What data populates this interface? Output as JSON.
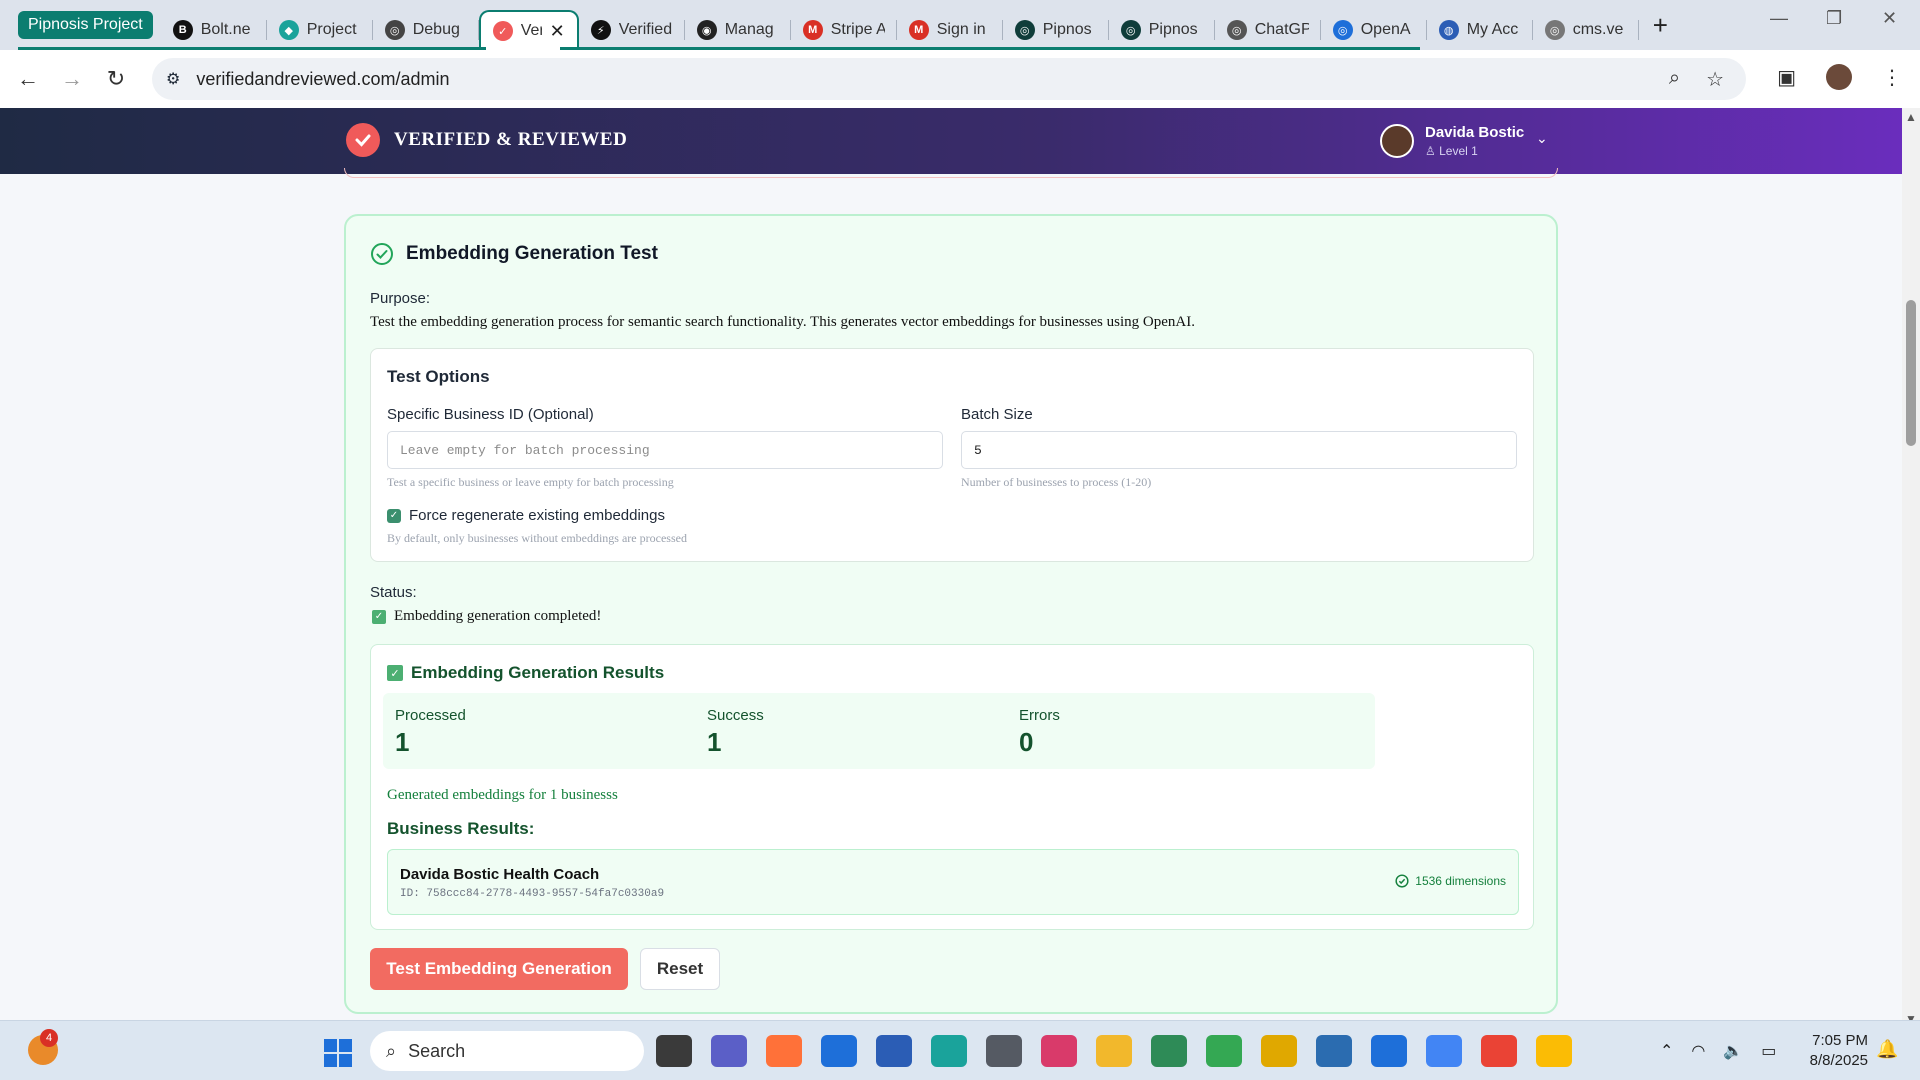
{
  "browser": {
    "group_chip": "Pipnosis Project",
    "tabs": [
      {
        "label": "Bolt.ne",
        "fav": "B",
        "color": "#111111"
      },
      {
        "label": "Project",
        "fav": "◆",
        "color": "#1aa39b"
      },
      {
        "label": "Debug",
        "fav": "◎",
        "color": "#444444"
      },
      {
        "label": "Ver",
        "fav": "✓",
        "color": "#f05a5a",
        "active": true
      },
      {
        "label": "Verified",
        "fav": "⚡",
        "color": "#111111"
      },
      {
        "label": "Manag",
        "fav": "◉",
        "color": "#222222"
      },
      {
        "label": "Stripe A",
        "fav": "M",
        "color": "#d93025"
      },
      {
        "label": "Sign in",
        "fav": "M",
        "color": "#d93025"
      },
      {
        "label": "Pipnos",
        "fav": "◎",
        "color": "#0f3d3a"
      },
      {
        "label": "Pipnos",
        "fav": "◎",
        "color": "#0f3d3a"
      },
      {
        "label": "ChatGP",
        "fav": "◎",
        "color": "#555555"
      },
      {
        "label": "OpenA",
        "fav": "◎",
        "color": "#1e6fd9"
      },
      {
        "label": "My Acc",
        "fav": "◍",
        "color": "#2b5db5"
      },
      {
        "label": "cms.ve",
        "fav": "◎",
        "color": "#777777"
      }
    ],
    "tab_close": "✕",
    "new_tab": "+",
    "url": "verifiedandreviewed.com/admin"
  },
  "site": {
    "brand": "VERIFIED & REVIEWED",
    "user_name": "Davida Bostic",
    "user_level": "Level 1"
  },
  "card": {
    "title": "Embedding Generation Test",
    "purpose_label": "Purpose:",
    "purpose_text": "Test the embedding generation process for semantic search functionality. This generates vector embeddings for businesses using OpenAI.",
    "options": {
      "title": "Test Options",
      "business_id_label": "Specific Business ID (Optional)",
      "business_id_placeholder": "Leave empty for batch processing",
      "business_id_help": "Test a specific business or leave empty for batch processing",
      "batch_size_label": "Batch Size",
      "batch_size_value": "5",
      "batch_size_help": "Number of businesses to process (1-20)",
      "force_label": "Force regenerate existing embeddings",
      "force_checked": true,
      "force_help": "By default, only businesses without embeddings are processed"
    },
    "status_label": "Status:",
    "status_text": "Embedding generation completed!",
    "results": {
      "title": "Embedding Generation Results",
      "stats": [
        {
          "label": "Processed",
          "value": "1"
        },
        {
          "label": "Success",
          "value": "1"
        },
        {
          "label": "Errors",
          "value": "0"
        }
      ],
      "generated_text": "Generated embeddings for 1 businesss",
      "business_results_label": "Business Results:",
      "business": {
        "name": "Davida Bostic Health Coach",
        "id": "ID: 758ccc84-2778-4493-9557-54fa7c0330a9",
        "dimensions": "1536 dimensions"
      }
    },
    "buttons": {
      "test": "Test Embedding Generation",
      "reset": "Reset"
    }
  },
  "taskbar": {
    "search_label": "Search",
    "notification_count": "4",
    "time": "7:05 PM",
    "date": "8/8/2025",
    "apps": [
      {
        "name": "task-view-icon",
        "color": "#3a3a3a"
      },
      {
        "name": "teams-icon",
        "color": "#5b5fc7"
      },
      {
        "name": "firefox-icon",
        "color": "#ff7139"
      },
      {
        "name": "mail-icon",
        "color": "#1e6fd9"
      },
      {
        "name": "store-icon",
        "color": "#2b5db5"
      },
      {
        "name": "edge-icon",
        "color": "#1aa39b"
      },
      {
        "name": "calculator-icon",
        "color": "#555a63"
      },
      {
        "name": "snipping-tool-icon",
        "color": "#d93a6a"
      },
      {
        "name": "file-explorer-icon",
        "color": "#f2b82c"
      },
      {
        "name": "money-app-icon",
        "color": "#2e8b57"
      },
      {
        "name": "chrome-profile-1-icon",
        "color": "#34a853"
      },
      {
        "name": "notes-app-icon",
        "color": "#e0a800"
      },
      {
        "name": "powershell-icon",
        "color": "#2b6cb0"
      },
      {
        "name": "notepad-icon",
        "color": "#1e6fd9"
      },
      {
        "name": "chrome-profile-2-icon",
        "color": "#4285f4"
      },
      {
        "name": "chrome-profile-3-icon",
        "color": "#ea4335"
      },
      {
        "name": "chrome-profile-4-icon",
        "color": "#fbbc05"
      }
    ]
  }
}
